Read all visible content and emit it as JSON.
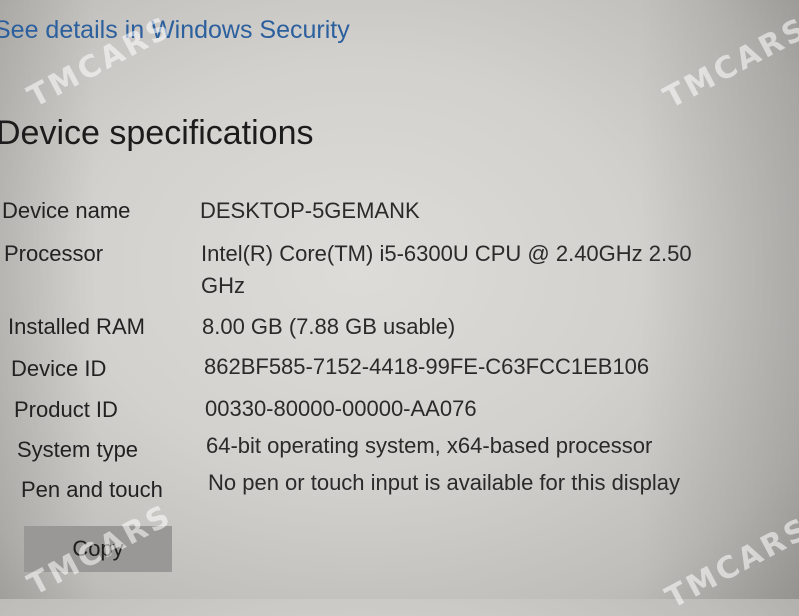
{
  "link": {
    "text": "See details in Windows Security"
  },
  "section": {
    "title": "Device specifications"
  },
  "specs": [
    {
      "label": "Device name",
      "value": "DESKTOP-5GEMANK"
    },
    {
      "label": "Processor",
      "value": "Intel(R) Core(TM) i5-6300U CPU @ 2.40GHz   2.50",
      "value_line2": "GHz"
    },
    {
      "label": "Installed RAM",
      "value": "8.00 GB (7.88 GB usable)"
    },
    {
      "label": "Device ID",
      "value": "862BF585-7152-4418-99FE-C63FCC1EB106"
    },
    {
      "label": "Product ID",
      "value": "00330-80000-00000-AA076"
    },
    {
      "label": "System type",
      "value": "64-bit operating system, x64-based processor"
    },
    {
      "label": "Pen and touch",
      "value": "No pen or touch input is available for this display"
    }
  ],
  "actions": {
    "copy_label": "Copy"
  },
  "watermark": {
    "text": "TMCARS"
  },
  "colors": {
    "link": "#2b5f9e",
    "background": "#d3d1cd",
    "button": "#9a9896"
  }
}
